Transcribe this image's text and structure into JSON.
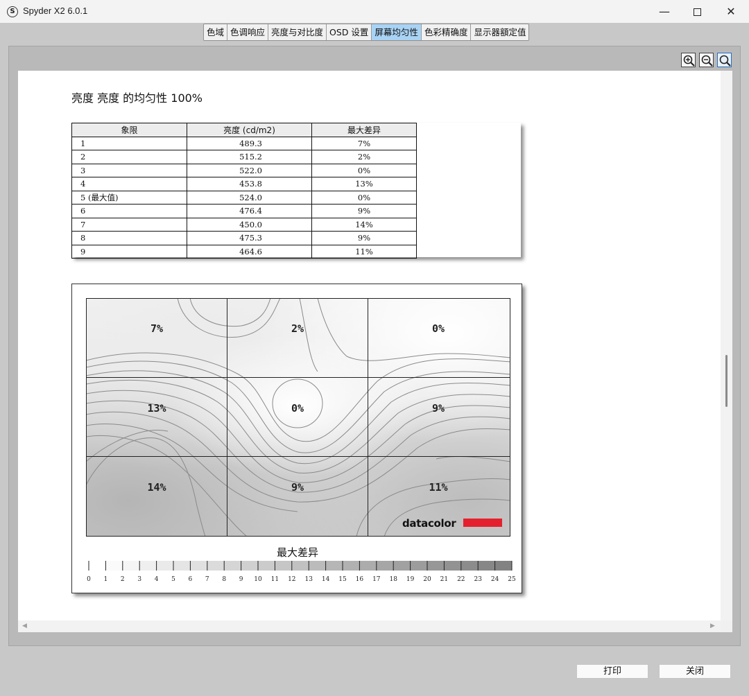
{
  "window": {
    "title": "Spyder X2 6.0.1",
    "app_icon_letter": "S",
    "minimize_glyph": "—",
    "close_glyph": "✕"
  },
  "tabs": [
    {
      "label": "色域"
    },
    {
      "label": "色调响应"
    },
    {
      "label": "亮度与对比度"
    },
    {
      "label": "OSD 设置"
    },
    {
      "label": "屏幕均匀性",
      "active": true
    },
    {
      "label": "色彩精确度"
    },
    {
      "label": "显示器額定值"
    }
  ],
  "toolbar": {
    "icons": [
      "zoom-in-icon",
      "zoom-out-icon",
      "zoom-fit-icon"
    ]
  },
  "report": {
    "title": "亮度 亮度 的均匀性 100%",
    "table": {
      "headers": [
        "象限",
        "亮度 (cd/m2)",
        "最大差异"
      ],
      "rows": [
        [
          "1",
          "489.3",
          "7%"
        ],
        [
          "2",
          "515.2",
          "2%"
        ],
        [
          "3",
          "522.0",
          "0%"
        ],
        [
          "4",
          "453.8",
          "13%"
        ],
        [
          "5 (最大值)",
          "524.0",
          "0%"
        ],
        [
          "6",
          "476.4",
          "9%"
        ],
        [
          "7",
          "450.0",
          "14%"
        ],
        [
          "8",
          "475.3",
          "9%"
        ],
        [
          "9",
          "464.6",
          "11%"
        ]
      ]
    },
    "uniformity_map": {
      "quadrant_labels": [
        "7%",
        "2%",
        "0%",
        "13%",
        "0%",
        "9%",
        "14%",
        "9%",
        "11%"
      ],
      "brand": "datacolor",
      "brand_color": "#e5202e"
    },
    "legend": {
      "title": "最大差异",
      "ticks": [
        "0",
        "1",
        "2",
        "3",
        "4",
        "5",
        "6",
        "7",
        "8",
        "9",
        "10",
        "11",
        "12",
        "13",
        "14",
        "15",
        "16",
        "17",
        "18",
        "19",
        "20",
        "21",
        "22",
        "23",
        "24",
        "25"
      ]
    }
  },
  "buttons": {
    "print": "打印",
    "close": "关闭"
  }
}
